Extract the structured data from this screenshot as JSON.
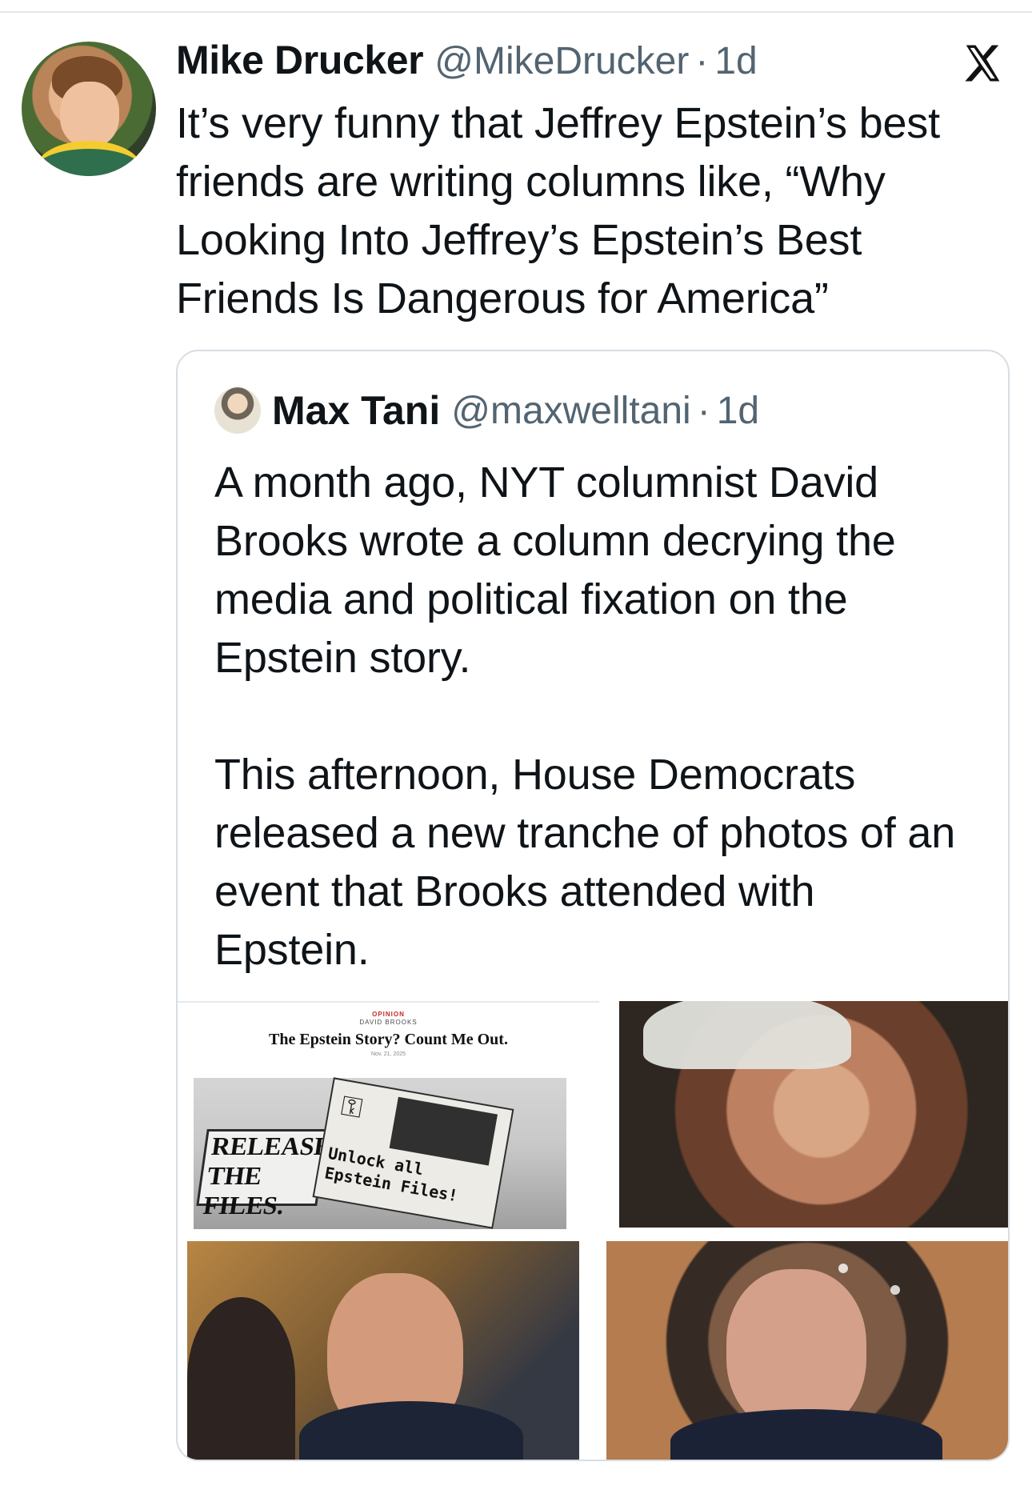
{
  "tweet": {
    "author": {
      "name": "Mike Drucker",
      "handle": "@MikeDrucker",
      "time": "1d"
    },
    "separator": "·",
    "text": "It’s very funny that Jeffrey Epstein’s best friends are writing columns like, “Why Looking Into Jeffrey’s Epstein’s Best Friends Is Dangerous for America”",
    "platform_icon": "x-logo-icon"
  },
  "quoted_tweet": {
    "author": {
      "name": "Max Tani",
      "handle": "@maxwelltani",
      "time": "1d"
    },
    "separator": "·",
    "paragraphs": [
      "A month ago, NYT columnist David Brooks wrote a column decrying the media and political fixation on the Epstein story.",
      "This afternoon, House Democrats released a new tranche of photos of an event that Brooks attended with Epstein."
    ],
    "media": {
      "nyt_screenshot": {
        "kicker": "OPINION",
        "byline": "DAVID BROOKS",
        "headline": "The Epstein Story? Count Me Out.",
        "date": "Nov. 21, 2025",
        "sign_left": [
          "RELEASE",
          "THE FILES."
        ],
        "sign_right": [
          "Unlock all",
          "Epstein Files!"
        ]
      },
      "photos": [
        "face-photo",
        "face-photo",
        "face-photo"
      ]
    }
  },
  "colors": {
    "text": "#0f1419",
    "secondary_text": "#536471",
    "border": "#d7dde2",
    "background": "#ffffff"
  }
}
